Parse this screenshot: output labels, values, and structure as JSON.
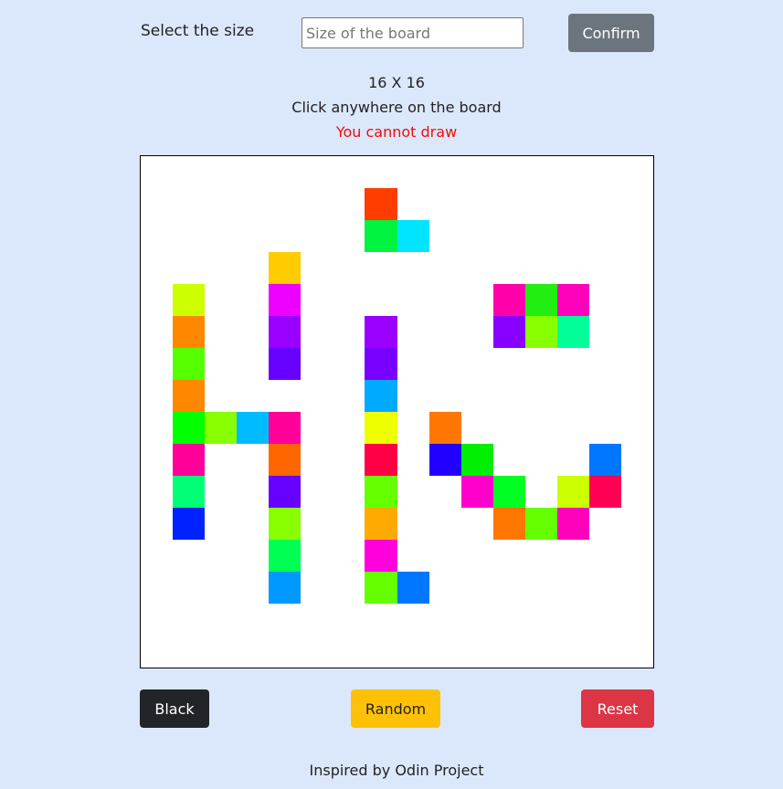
{
  "controls": {
    "size_label": "Select the size",
    "size_input_placeholder": "Size of the board",
    "size_input_value": "",
    "confirm_label": "Confirm"
  },
  "status": {
    "board_size": "16 X 16",
    "instruction": "Click anywhere on the board",
    "warning": "You cannot draw",
    "warning_color": "#f20c0c"
  },
  "board": {
    "grid_size": 16,
    "background": "#ffffff",
    "filled_cells": [
      {
        "row": 1,
        "col": 7,
        "color": "#ff3d00"
      },
      {
        "row": 2,
        "col": 7,
        "color": "#00f33f"
      },
      {
        "row": 2,
        "col": 8,
        "color": "#00e5ff"
      },
      {
        "row": 3,
        "col": 4,
        "color": "#ffcc00"
      },
      {
        "row": 4,
        "col": 1,
        "color": "#ccff00"
      },
      {
        "row": 4,
        "col": 4,
        "color": "#ee00ff"
      },
      {
        "row": 4,
        "col": 11,
        "color": "#ff00aa"
      },
      {
        "row": 4,
        "col": 12,
        "color": "#22ee11"
      },
      {
        "row": 4,
        "col": 13,
        "color": "#ff00bb"
      },
      {
        "row": 5,
        "col": 1,
        "color": "#ff8800"
      },
      {
        "row": 5,
        "col": 4,
        "color": "#9900ff"
      },
      {
        "row": 5,
        "col": 7,
        "color": "#9900ff"
      },
      {
        "row": 5,
        "col": 11,
        "color": "#8800ff"
      },
      {
        "row": 5,
        "col": 12,
        "color": "#88ff00"
      },
      {
        "row": 5,
        "col": 13,
        "color": "#00ff99"
      },
      {
        "row": 6,
        "col": 1,
        "color": "#55ff00"
      },
      {
        "row": 6,
        "col": 4,
        "color": "#6600ff"
      },
      {
        "row": 6,
        "col": 7,
        "color": "#7700ff"
      },
      {
        "row": 7,
        "col": 1,
        "color": "#ff8800"
      },
      {
        "row": 7,
        "col": 7,
        "color": "#00aaff"
      },
      {
        "row": 8,
        "col": 1,
        "color": "#00ff00"
      },
      {
        "row": 8,
        "col": 2,
        "color": "#88ff00"
      },
      {
        "row": 8,
        "col": 3,
        "color": "#00bbff"
      },
      {
        "row": 8,
        "col": 4,
        "color": "#ff0099"
      },
      {
        "row": 8,
        "col": 7,
        "color": "#eeff00"
      },
      {
        "row": 8,
        "col": 9,
        "color": "#ff7700"
      },
      {
        "row": 9,
        "col": 1,
        "color": "#ff0099"
      },
      {
        "row": 9,
        "col": 4,
        "color": "#ff6600"
      },
      {
        "row": 9,
        "col": 7,
        "color": "#ff0044"
      },
      {
        "row": 9,
        "col": 9,
        "color": "#2200ff"
      },
      {
        "row": 9,
        "col": 10,
        "color": "#00ee00"
      },
      {
        "row": 9,
        "col": 14,
        "color": "#0077ff"
      },
      {
        "row": 10,
        "col": 1,
        "color": "#00ff77"
      },
      {
        "row": 10,
        "col": 4,
        "color": "#6600ff"
      },
      {
        "row": 10,
        "col": 7,
        "color": "#66ff00"
      },
      {
        "row": 10,
        "col": 10,
        "color": "#ff00cc"
      },
      {
        "row": 10,
        "col": 11,
        "color": "#00ff22"
      },
      {
        "row": 10,
        "col": 13,
        "color": "#ccff00"
      },
      {
        "row": 10,
        "col": 14,
        "color": "#ff0055"
      },
      {
        "row": 11,
        "col": 1,
        "color": "#0022ff"
      },
      {
        "row": 11,
        "col": 4,
        "color": "#88ff00"
      },
      {
        "row": 11,
        "col": 7,
        "color": "#ffaa00"
      },
      {
        "row": 11,
        "col": 11,
        "color": "#ff7700"
      },
      {
        "row": 11,
        "col": 12,
        "color": "#66ff00"
      },
      {
        "row": 11,
        "col": 13,
        "color": "#ff00bb"
      },
      {
        "row": 12,
        "col": 4,
        "color": "#00ff55"
      },
      {
        "row": 12,
        "col": 7,
        "color": "#ff00dd"
      },
      {
        "row": 13,
        "col": 4,
        "color": "#0099ff"
      },
      {
        "row": 13,
        "col": 7,
        "color": "#66ff00"
      },
      {
        "row": 13,
        "col": 8,
        "color": "#0077ff"
      }
    ]
  },
  "actions": {
    "black_label": "Black",
    "random_label": "Random",
    "reset_label": "Reset"
  },
  "footer": {
    "text": "Inspired by Odin Project"
  }
}
